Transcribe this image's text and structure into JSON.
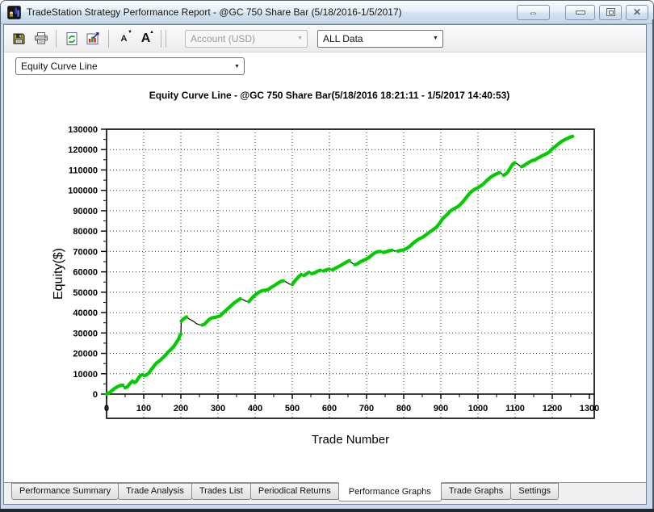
{
  "window": {
    "title": "TradeStation Strategy Performance Report - @GC 750 Share Bar (5/18/2016-1/5/2017)"
  },
  "icons": {
    "expand": "⇔",
    "close": "✕",
    "dropdown": "▼",
    "tri_up": "▲",
    "tri_down": "▼",
    "font_letter": "A"
  },
  "toolbar": {
    "account_selector": "Account (USD)",
    "interval_selector": "ALL Data"
  },
  "graph_selector": "Equity Curve Line",
  "tabs": [
    {
      "label": "Performance Summary",
      "active": false
    },
    {
      "label": "Trade Analysis",
      "active": false
    },
    {
      "label": "Trades List",
      "active": false
    },
    {
      "label": "Periodical Returns",
      "active": false
    },
    {
      "label": "Performance Graphs",
      "active": true
    },
    {
      "label": "Trade Graphs",
      "active": false
    },
    {
      "label": "Settings",
      "active": false
    }
  ],
  "chart_data": {
    "type": "line",
    "title": "Equity Curve Line - @GC 750 Share Bar(5/18/2016 18:21:11 - 1/5/2017 14:40:53)",
    "xlabel": "Trade Number",
    "ylabel": "Equity($)",
    "xlim": [
      0,
      1313
    ],
    "ylim": [
      -11900,
      130000
    ],
    "x_ticks": [
      0,
      100,
      200,
      300,
      400,
      500,
      600,
      700,
      800,
      900,
      1000,
      1100,
      1200,
      1300
    ],
    "y_ticks": [
      0,
      10000,
      20000,
      30000,
      40000,
      50000,
      60000,
      70000,
      80000,
      90000,
      100000,
      110000,
      120000,
      130000
    ],
    "grid": "dotted",
    "legend": "none",
    "series": [
      {
        "name": "Equity",
        "up_color": "#00cc00",
        "down_color": "#000000",
        "points": [
          [
            0,
            0
          ],
          [
            8,
            800
          ],
          [
            15,
            1800
          ],
          [
            22,
            2800
          ],
          [
            30,
            3700
          ],
          [
            38,
            4300
          ],
          [
            44,
            4400
          ],
          [
            50,
            3100
          ],
          [
            56,
            3600
          ],
          [
            62,
            5000
          ],
          [
            70,
            6400
          ],
          [
            75,
            5700
          ],
          [
            80,
            6200
          ],
          [
            86,
            8000
          ],
          [
            92,
            9200
          ],
          [
            97,
            9600
          ],
          [
            102,
            9000
          ],
          [
            108,
            9500
          ],
          [
            114,
            10300
          ],
          [
            120,
            12000
          ],
          [
            127,
            13500
          ],
          [
            134,
            15200
          ],
          [
            142,
            16200
          ],
          [
            150,
            17600
          ],
          [
            157,
            18800
          ],
          [
            165,
            20500
          ],
          [
            172,
            21700
          ],
          [
            180,
            23200
          ],
          [
            187,
            25000
          ],
          [
            194,
            27000
          ],
          [
            199,
            29300
          ],
          [
            200,
            29500
          ],
          [
            201,
            35800
          ],
          [
            205,
            36600
          ],
          [
            210,
            37200
          ],
          [
            215,
            37900
          ],
          [
            222,
            36900
          ],
          [
            228,
            36300
          ],
          [
            235,
            35600
          ],
          [
            242,
            34600
          ],
          [
            250,
            34000
          ],
          [
            257,
            33900
          ],
          [
            263,
            34200
          ],
          [
            270,
            35500
          ],
          [
            277,
            36800
          ],
          [
            284,
            37400
          ],
          [
            290,
            37600
          ],
          [
            297,
            37900
          ],
          [
            305,
            38300
          ],
          [
            312,
            39500
          ],
          [
            320,
            40900
          ],
          [
            328,
            42200
          ],
          [
            336,
            43500
          ],
          [
            344,
            44800
          ],
          [
            352,
            45800
          ],
          [
            360,
            46800
          ],
          [
            368,
            46300
          ],
          [
            376,
            45500
          ],
          [
            383,
            45400
          ],
          [
            390,
            46800
          ],
          [
            397,
            48200
          ],
          [
            404,
            49200
          ],
          [
            412,
            50200
          ],
          [
            420,
            50800
          ],
          [
            428,
            51000
          ],
          [
            435,
            51300
          ],
          [
            443,
            52400
          ],
          [
            451,
            53200
          ],
          [
            460,
            54300
          ],
          [
            468,
            55200
          ],
          [
            476,
            55600
          ],
          [
            484,
            55000
          ],
          [
            492,
            54000
          ],
          [
            500,
            53800
          ],
          [
            508,
            55800
          ],
          [
            516,
            57400
          ],
          [
            524,
            58700
          ],
          [
            531,
            58200
          ],
          [
            538,
            59000
          ],
          [
            545,
            59800
          ],
          [
            552,
            59100
          ],
          [
            560,
            59500
          ],
          [
            568,
            60300
          ],
          [
            576,
            60800
          ],
          [
            584,
            60400
          ],
          [
            592,
            61000
          ],
          [
            600,
            61400
          ],
          [
            608,
            61000
          ],
          [
            616,
            61800
          ],
          [
            624,
            62500
          ],
          [
            632,
            63300
          ],
          [
            640,
            64200
          ],
          [
            648,
            65000
          ],
          [
            654,
            65500
          ],
          [
            660,
            64400
          ],
          [
            668,
            63500
          ],
          [
            675,
            63900
          ],
          [
            682,
            64800
          ],
          [
            690,
            65500
          ],
          [
            698,
            66200
          ],
          [
            706,
            67000
          ],
          [
            714,
            68200
          ],
          [
            722,
            69300
          ],
          [
            730,
            69900
          ],
          [
            738,
            70000
          ],
          [
            745,
            69500
          ],
          [
            752,
            69800
          ],
          [
            760,
            70300
          ],
          [
            768,
            70600
          ],
          [
            776,
            70300
          ],
          [
            784,
            70200
          ],
          [
            792,
            70500
          ],
          [
            800,
            70800
          ],
          [
            808,
            71500
          ],
          [
            816,
            72500
          ],
          [
            824,
            73800
          ],
          [
            832,
            75000
          ],
          [
            840,
            76000
          ],
          [
            848,
            76700
          ],
          [
            856,
            77600
          ],
          [
            864,
            78700
          ],
          [
            872,
            79800
          ],
          [
            880,
            80800
          ],
          [
            888,
            81900
          ],
          [
            896,
            83700
          ],
          [
            904,
            85800
          ],
          [
            911,
            87200
          ],
          [
            918,
            88300
          ],
          [
            925,
            89800
          ],
          [
            932,
            90600
          ],
          [
            940,
            91400
          ],
          [
            947,
            92200
          ],
          [
            954,
            93300
          ],
          [
            961,
            94800
          ],
          [
            968,
            96400
          ],
          [
            976,
            98200
          ],
          [
            983,
            99500
          ],
          [
            990,
            100400
          ],
          [
            998,
            101100
          ],
          [
            1006,
            102000
          ],
          [
            1013,
            102900
          ],
          [
            1020,
            104200
          ],
          [
            1028,
            105500
          ],
          [
            1036,
            106700
          ],
          [
            1044,
            107600
          ],
          [
            1052,
            108200
          ],
          [
            1058,
            108700
          ],
          [
            1063,
            108300
          ],
          [
            1069,
            107400
          ],
          [
            1075,
            108000
          ],
          [
            1081,
            109200
          ],
          [
            1087,
            111000
          ],
          [
            1093,
            112700
          ],
          [
            1099,
            113600
          ],
          [
            1105,
            113100
          ],
          [
            1111,
            112200
          ],
          [
            1117,
            111600
          ],
          [
            1123,
            112100
          ],
          [
            1129,
            112800
          ],
          [
            1135,
            113500
          ],
          [
            1141,
            114200
          ],
          [
            1147,
            114700
          ],
          [
            1153,
            114900
          ],
          [
            1159,
            115600
          ],
          [
            1166,
            116300
          ],
          [
            1173,
            117000
          ],
          [
            1180,
            117600
          ],
          [
            1187,
            118200
          ],
          [
            1193,
            119000
          ],
          [
            1199,
            120200
          ],
          [
            1206,
            121200
          ],
          [
            1213,
            122300
          ],
          [
            1220,
            123300
          ],
          [
            1227,
            124200
          ],
          [
            1234,
            124900
          ],
          [
            1241,
            125500
          ],
          [
            1248,
            126100
          ],
          [
            1255,
            126500
          ]
        ]
      }
    ]
  }
}
